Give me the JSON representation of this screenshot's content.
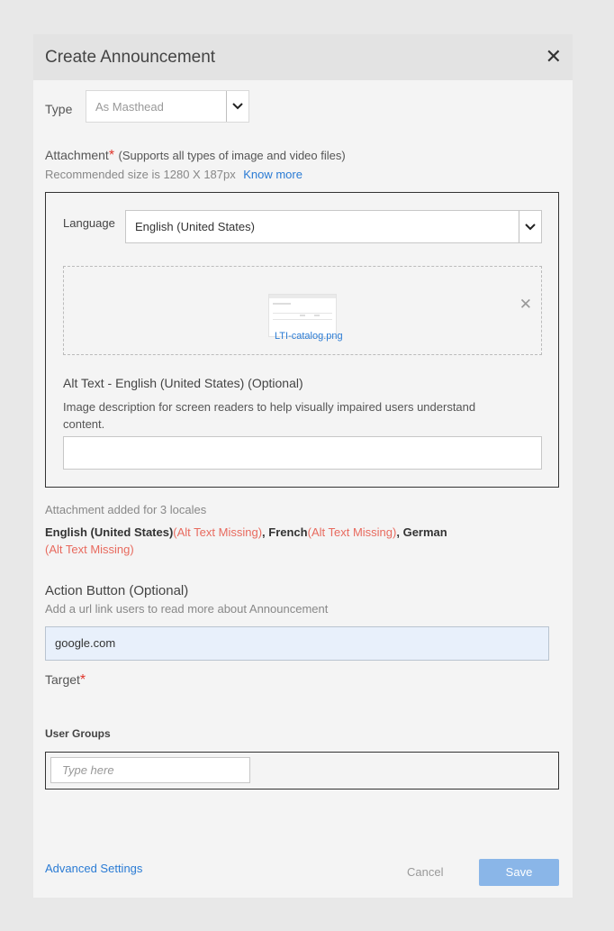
{
  "dialog": {
    "title": "Create Announcement",
    "type_label": "Type",
    "type_value": "As Masthead",
    "attachment_label": "Attachment",
    "attachment_required": "*",
    "attachment_note": "(Supports all types of image and video files)",
    "recommended_size": "Recommended size is 1280 X 187px",
    "know_more": "Know more",
    "language_label": "Language",
    "language_value": "English (United States)",
    "file_name": "LTI-catalog.png",
    "alt_text_title": "Alt Text - English (United States) (Optional)",
    "alt_text_desc": "Image description for screen readers to help visually impaired users understand content.",
    "alt_text_value": "",
    "locales_summary": "Attachment added for 3 locales",
    "locales": [
      {
        "name": "English (United States)",
        "status": "(Alt Text Missing)"
      },
      {
        "name": "French",
        "status": "(Alt Text Missing)"
      },
      {
        "name": "German",
        "status": "(Alt Text Missing)"
      }
    ],
    "action_button_label": "Action Button (Optional)",
    "action_button_desc": "Add a url link users to read more about Announcement",
    "action_url": "google.com",
    "target_label": "Target",
    "target_required": "*",
    "user_groups_label": "User Groups",
    "user_groups_placeholder": "Type here",
    "advanced_settings": "Advanced Settings",
    "cancel": "Cancel",
    "save": "Save"
  },
  "colors": {
    "accent": "#2a7bd4",
    "required": "#e0352b",
    "warning": "#e86a5e",
    "save_button": "#8ab6e8"
  }
}
